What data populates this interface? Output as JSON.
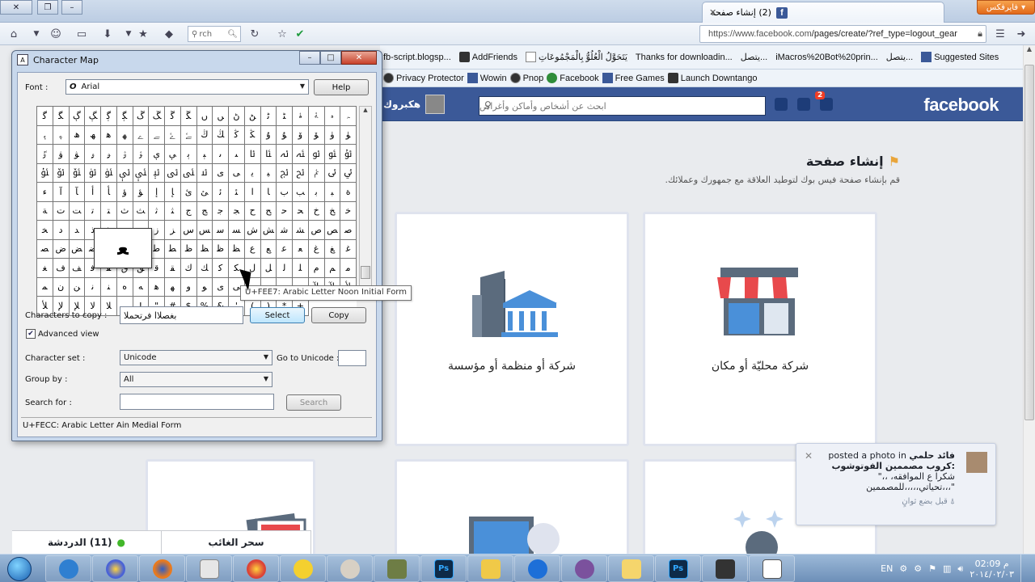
{
  "browser": {
    "menu_label": "فايرفكس",
    "tab_title": "(2) إنشاء صفحة",
    "url_host": "https://www.facebook.com",
    "url_path": "/pages/create/?ref_type=logout_gear",
    "search_placeholder": "rch",
    "bookmarks": [
      "fb-script.blogsp...",
      "AddFriends",
      "يَتَحَوَّلُ الْعُلُوُّ بِالْمَجْمُوعَاتِ",
      "Thanks for downloadin...",
      "يتصل...",
      "iMacros%20Bot%20prin...",
      "يتصل...",
      "Suggested Sites"
    ],
    "bookmarks2": [
      "Privacy Protector",
      "Wowin",
      "Pnop",
      "Facebook",
      "Free Games",
      "Launch Downtango"
    ]
  },
  "facebook": {
    "logo": "facebook",
    "search_placeholder": "ابحث عن أشخاص وأماكن وأغراض",
    "notif_count": "2",
    "user_name": "هكبروك",
    "page_title": "إنشاء صفحة",
    "page_subtitle": "قم بإنشاء صفحة فيس بوك لتوطيد العلاقة مع جمهورك وعملائك.",
    "card_local": "شركة محليّة أو مكان",
    "card_company": "شركة أو منظمة أو مؤسسة",
    "chat_label": "(11) الدردشة",
    "chat_tab2": "سحر الغائب",
    "notification": {
      "name": "فائد حلمي",
      "action": "posted a photo in",
      "group": "كروب مصممين الفوتوشوب:",
      "text": "\"شكرا ع الموافقه، ،، تحياتي،،،،،للمصممين،،،\"",
      "time": "قبل بضع ثوانٍ"
    }
  },
  "charmap": {
    "title": "Character Map",
    "font_label": "Font :",
    "font_value": "Arial",
    "help_label": "Help",
    "chars": [
      "ﮔ",
      "ﮕ",
      "ﮖ",
      "ﮗ",
      "ﮘ",
      "ﮙ",
      "ﮚ",
      "ﮛ",
      "ﮜ",
      "ﮝ",
      "ﮞ",
      "ﮟ",
      "ﮠ",
      "ﮡ",
      "ﮢ",
      "ﮣ",
      "ﮤ",
      "ﮥ",
      "ﮦ",
      "ﮧ",
      "ﮨ",
      "ﮩ",
      "ﮪ",
      "ﮫ",
      "ﮬ",
      "ﮭ",
      "ﮮ",
      "ﮯ",
      "ﮰ",
      "ﮱ",
      "ﯓ",
      "ﯔ",
      "ﯕ",
      "ﯖ",
      "ﯗ",
      "ﯘ",
      "ﯙ",
      "ﯚ",
      "ﯛ",
      "ﯜ",
      "ﯝ",
      "ﯞ",
      "ﯟ",
      "ﯠ",
      "ﯡ",
      "ﯢ",
      "ﯣ",
      "ﯤ",
      "ﯥ",
      "ﯦ",
      "ﯧ",
      "ﯨ",
      "ﯩ",
      "ﯪ",
      "ﯫ",
      "ﯬ",
      "ﯭ",
      "ﯮ",
      "ﯯ",
      "ﯰ",
      "ﯱ",
      "ﯲ",
      "ﯳ",
      "ﯴ",
      "ﯵ",
      "ﯶ",
      "ﯷ",
      "ﯸ",
      "ﯹ",
      "ﯺ",
      "ﯻ",
      "ﯼ",
      "ﯽ",
      "ﯾ",
      "ﯿ",
      "ﰀ",
      "ﰁ",
      "ﰂ",
      "ﰃ",
      "ﰄ",
      "ﺀ",
      "ﺁ",
      "ﺂ",
      "ﺃ",
      "ﺄ",
      "ﺅ",
      "ﺆ",
      "ﺇ",
      "ﺈ",
      "ﺉ",
      "ﺊ",
      "ﺋ",
      "ﺌ",
      "ﺍ",
      "ﺎ",
      "ﺏ",
      "ﺐ",
      "ﺑ",
      "ﺒ",
      "ﺓ",
      "ﺔ",
      "ﺕ",
      "ﺖ",
      "ﺗ",
      "ﺘ",
      "ﺙ",
      "ﺚ",
      "ﺛ",
      "ﺜ",
      "ﺝ",
      "ﺞ",
      "ﺟ",
      "ﺠ",
      "ﺡ",
      "ﺢ",
      "ﺣ",
      "ﺤ",
      "ﺥ",
      "ﺦ",
      "ﺧ",
      "ﺨ",
      "ﺩ",
      "ﺪ",
      "ﺫ",
      "ﺬ",
      "ﺭ",
      "ﺮ",
      "ﺯ",
      "ﺰ",
      "ﺱ",
      "ﺲ",
      "ﺳ",
      "ﺴ",
      "ﺵ",
      "ﺶ",
      "ﺷ",
      "ﺸ",
      "ﺹ",
      "ﺺ",
      "ﺻ",
      "ﺼ",
      "ﺽ",
      "ﺾ",
      "ﺿ",
      "ﻀ",
      "ﻁ",
      "ﻂ",
      "ﻃ",
      "ﻄ",
      "ﻅ",
      "ﻆ",
      "ﻇ",
      "ﻈ",
      "ﻉ",
      "ﻊ",
      "ﻋ",
      "ﻌ",
      "ﻍ",
      "ﻎ",
      "ﻏ",
      "ﻐ",
      "ﻑ",
      "ﻒ",
      "ﻓ",
      "ﻔ",
      "ﻕ",
      "ﻖ",
      "ﻗ",
      "ﻘ",
      "ﻙ",
      "ﻚ",
      "ﻛ",
      "ﻜ",
      "ﻝ",
      "ﻞ",
      "ﻟ",
      "ﻠ",
      "ﻡ",
      "ﻢ",
      "ﻣ",
      "ﻤ",
      "ﻥ",
      "ﻦ",
      "ﻧ",
      "ﻨ",
      "ﻩ",
      "ﻪ",
      "ﻫ",
      "ﻬ",
      "ﻭ",
      "ﻮ",
      "ﻯ",
      "ﻰ",
      "ﻱ",
      "ﻲ",
      "ﻳ",
      "ﻴ",
      "ﻵ",
      "ﻶ",
      "ﻷ",
      "ﻸ",
      "ﻹ",
      "ﻺ",
      "ﻻ",
      "ﻼ",
      "﻿",
      "!",
      "\"",
      "#",
      "$",
      "%",
      "&",
      "'",
      "(",
      ")",
      "*",
      "+"
    ],
    "magnified_char": "ﻌ",
    "tooltip": "U+FEE7: Arabic Letter Noon Initial Form",
    "chars_to_copy_label": "Characters to copy :",
    "chars_to_copy_value": "بغصلاا فرتحملا",
    "select_label": "Select",
    "copy_label": "Copy",
    "advanced_label": "Advanced view",
    "charset_label": "Character set :",
    "charset_value": "Unicode",
    "goto_label": "Go to Unicode :",
    "groupby_label": "Group by :",
    "groupby_value": "All",
    "search_label": "Search for :",
    "search_button": "Search",
    "status": "U+FECC: Arabic Letter Ain Medial Form"
  },
  "taskbar": {
    "lang": "EN",
    "time": "02:09 م",
    "date": "٢٠١٤/٠٢/٠٣"
  },
  "colors": {
    "facebook_blue": "#3b5998",
    "firefox_orange": "#e2691a"
  }
}
